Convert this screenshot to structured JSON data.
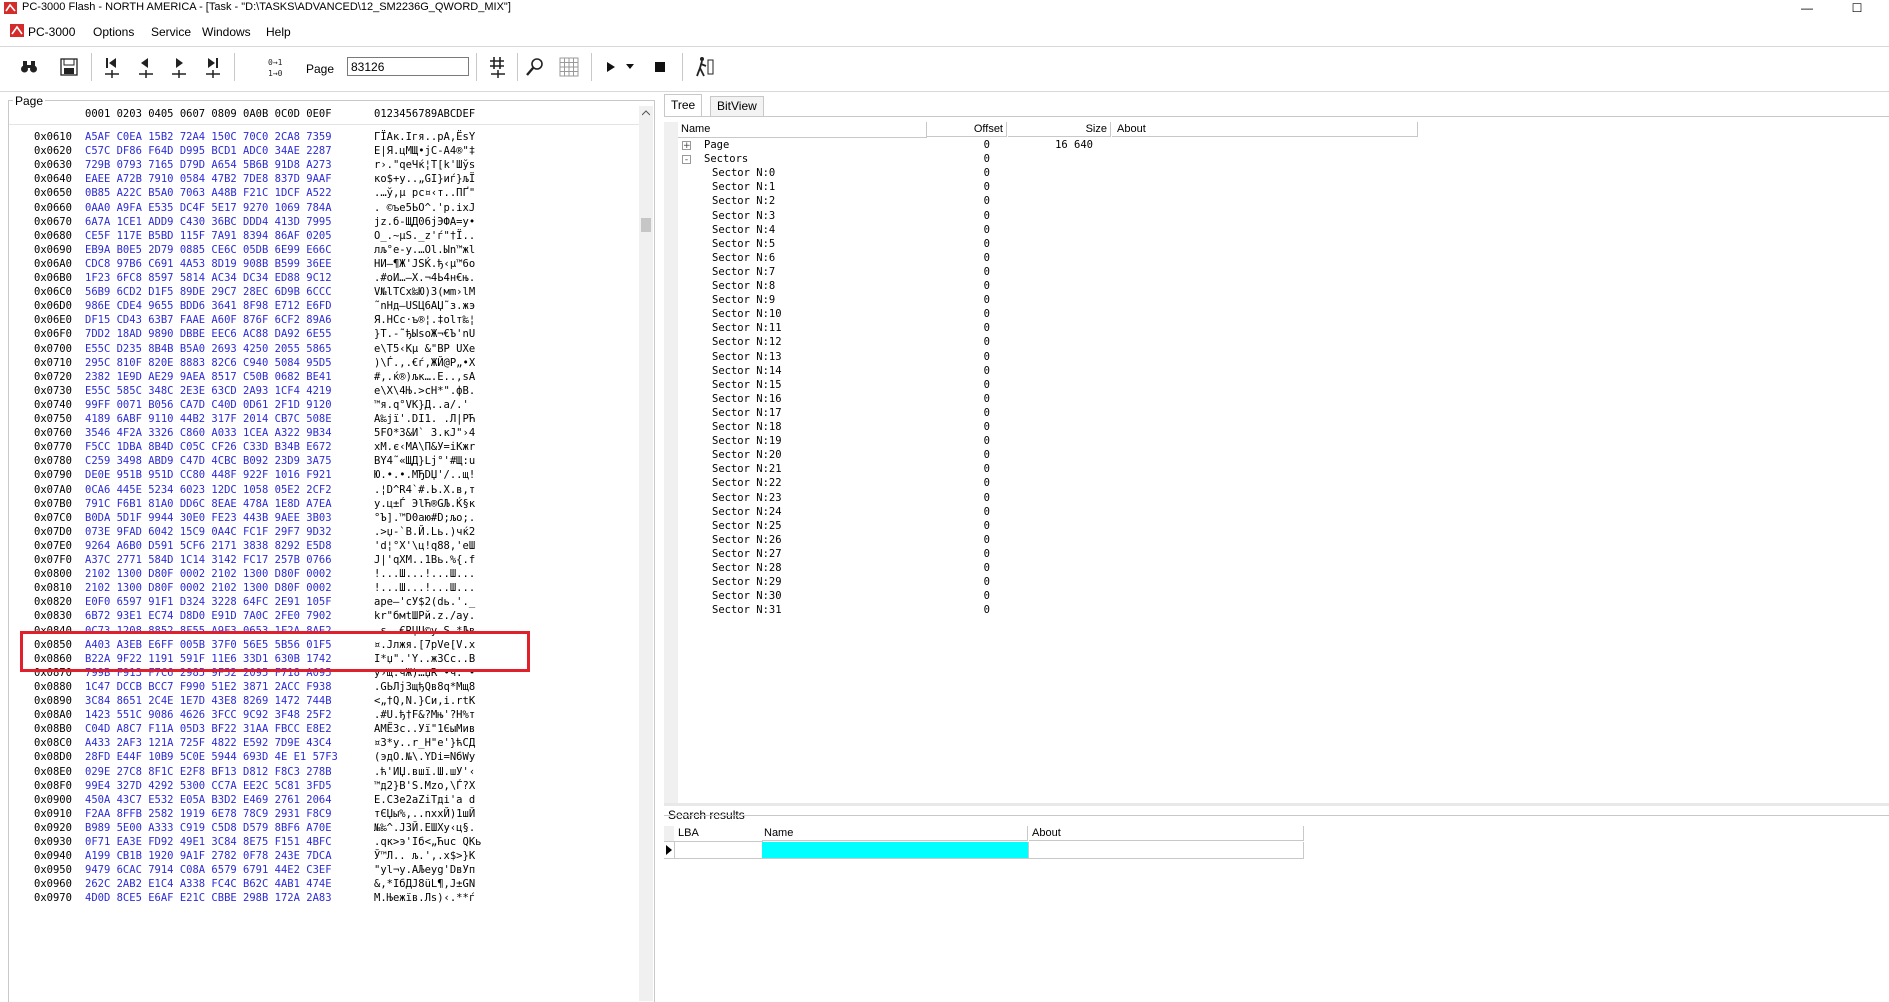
{
  "window": {
    "title": "PC-3000 Flash - NORTH AMERICA - [Task - \"D:\\TASKS\\ADVANCED\\12_SM2236G_QWORD_MIX\"]"
  },
  "menu": {
    "items": [
      "PC-3000",
      "Options",
      "Service",
      "Windows",
      "Help"
    ]
  },
  "toolbar": {
    "page_label": "Page",
    "page_value": "83126"
  },
  "hex_panel": {
    "group_label": "Page",
    "header_columns": "0001 0203 0405 0607 0809 0A0B 0C0D 0E0F",
    "header_ascii": "0123456789ABCDEF",
    "rows": [
      {
        "addr": "0x0610",
        "hex": "A5AF C0EA 15B2 72A4 150C 70C0 2CA8 7359",
        "ascii": "ГЇАк.Ігя..рА,ЁsY"
      },
      {
        "addr": "0x0620",
        "hex": "C57C DF86 F64D D995 BCD1 ADC0 34AE 2287",
        "ascii": "Е|Я.цМЩ•јС-А4®\"‡"
      },
      {
        "addr": "0x0630",
        "hex": "729B 0793 7165 D79D A654 5B6B 91D8 A273",
        "ascii": "r›.\"qeЧќ¦T[k'Шўs"
      },
      {
        "addr": "0x0640",
        "hex": "EAEE A72B 7910 0584 47B2 7DE8 837D 9AAF",
        "ascii": "ко$+y..„GІ}иѓ}љЇ"
      },
      {
        "addr": "0x0650",
        "hex": "0B85 A22C B5A0 7063 A48B F21C 1DCF A522",
        "ascii": ".…ў,µ рс¤‹т..ПҐ\""
      },
      {
        "addr": "0x0660",
        "hex": "0AA0 A9FA E535 DC4F 5E17 9270 1069 784A",
        "ascii": ". ©ъе5ЬO^.'p.ixJ"
      },
      {
        "addr": "0x0670",
        "hex": "6A7A 1CE1 ADD9 C430 36BC DDD4 413D 7995",
        "ascii": "jz.б-ЩД06јЭФA=y•"
      },
      {
        "addr": "0x0680",
        "hex": "CE5F 117E B5BD 115F 7A91 8394 86AF 0205",
        "ascii": "О_.~µЅ._z'ѓ\"†Ї.."
      },
      {
        "addr": "0x0690",
        "hex": "EB9A B0E5 2D79 0885 CE6C 05DB 6E99 E66C",
        "ascii": "лљ°е-y.…Оl.Ыn™жl"
      },
      {
        "addr": "0x06A0",
        "hex": "CDC8 97B6 C691 4A53 8D19 908B B599 36EE",
        "ascii": "НИ—¶Ж'JSЌ.ђ‹µ™6о"
      },
      {
        "addr": "0x06B0",
        "hex": "1F23 6FC8 8597 5814 AC34 DC34 ED88 9C12",
        "ascii": ".#oИ…—X.¬4Ь4н€њ."
      },
      {
        "addr": "0x06C0",
        "hex": "56B9 6CD2 D1F5 89DE 29C7 28EC 6D9B 6CCC",
        "ascii": "V№lТСх‰Ю)З(мm›lМ"
      },
      {
        "addr": "0x06D0",
        "hex": "986E CDE4 9655 BDD6 3641 8F98 E712 E6FD",
        "ascii": "˜nНд–UЅЦ6AЏ˜з.жэ"
      },
      {
        "addr": "0x06E0",
        "hex": "DF15 CD43 63B7 FAAE A60F 876F 6CF2 89A6",
        "ascii": "Я.НCc·ъ®¦.‡olт‰¦"
      },
      {
        "addr": "0x06F0",
        "hex": "7DD2 18AD 9890 DBBE EEC6 AC88 DA92 6E55",
        "ascii": "}Т.-˜ђЫѕоЖ¬€Ъ'nU"
      },
      {
        "addr": "0x0700",
        "hex": "E55C D235 8B4B B5A0 2693 4250 2055 5865",
        "ascii": "е\\Т5‹Kµ &\"BP UXe"
      },
      {
        "addr": "0x0710",
        "hex": "295C 810F 820E 8883 82C6 C940 5084 95D5",
        "ascii": ")\\Ѓ.‚.€ѓ‚ЖЙ@P„•Х"
      },
      {
        "addr": "0x0720",
        "hex": "2382 1E9D AE29 9AEA 8517 C50B 0682 BE41",
        "ascii": "#‚.ќ®)љк….Е..‚ѕA"
      },
      {
        "addr": "0x0730",
        "hex": "E55C 585C 348C 2E3E 63CD 2A93 1CF4 4219",
        "ascii": "е\\X\\4Њ.>cН*\".фB."
      },
      {
        "addr": "0x0740",
        "hex": "99FF 0071 B056 CA7D C40D 0D61 2F1D 9120",
        "ascii": "™я.q°VК}Д..a/.' "
      },
      {
        "addr": "0x0750",
        "hex": "4189 6ABF 9110 44B2 317F 2014 CB7C 508E",
        "ascii": "A‰jї'.DІ1. .Л|PЋ"
      },
      {
        "addr": "0x0760",
        "hex": "3546 4F2A 3326 C860 A033 1CEA A322 9B34",
        "ascii": "5FO*3&И` 3.кЈ\"›4"
      },
      {
        "addr": "0x0770",
        "hex": "F5CC 1DBA 8B4D C05C CF26 C33D B34B E672",
        "ascii": "хМ.є‹MА\\П&У=іKжr"
      },
      {
        "addr": "0x0780",
        "hex": "C259 3498 ABD9 C47D 4CBC B092 23D9 3A75",
        "ascii": "ВY4˜«ЩД}Lј°'#Щ:u"
      },
      {
        "addr": "0x0790",
        "hex": "DE0E 951B 951D CC80 448F 922F 1016 F921",
        "ascii": "Ю.•.•.МЂDЏ'/..щ!"
      },
      {
        "addr": "0x07A0",
        "hex": "0CA6 445E 5234 6023 12DC 1058 05E2 2CF2",
        "ascii": ".¦D^R4`#.Ь.X.в,т"
      },
      {
        "addr": "0x07B0",
        "hex": "791C F6B1 81A0 DD6C 8EAE 478A 1E8D A7EA",
        "ascii": "y.ц±Ѓ ЭlЋ®GЉ.Ќ§к"
      },
      {
        "addr": "0x07C0",
        "hex": "B0DA 5D1F 9944 30E0 FE23 443B 9AEE 3B03",
        "ascii": "°Ъ].™D0аю#D;љо;."
      },
      {
        "addr": "0x07D0",
        "hex": "073E 9FAD 6042 15C9 0A4C FC1F 29F7 9D32",
        "ascii": ".>џ-`B.Й.Lь.)чќ2"
      },
      {
        "addr": "0x07E0",
        "hex": "9264 A6B0 D591 5CF6 2171 3838 8292 E5D8",
        "ascii": "'d¦°Х'\\ц!q88‚'еШ"
      },
      {
        "addr": "0x07F0",
        "hex": "A37C 2771 584D 1C14 3142 FC17 257B 0766",
        "ascii": "Ј|'qXM..1Bь.%{.f"
      },
      {
        "addr": "0x0800",
        "hex": "2102 1300 D80F 0002 2102 1300 D80F 0002",
        "ascii": "!...Ш...!...Ш..."
      },
      {
        "addr": "0x0810",
        "hex": "2102 1300 D80F 0002 2102 1300 D80F 0002",
        "ascii": "!...Ш...!...Ш..."
      },
      {
        "addr": "0x0820",
        "hex": "E0F0 6597 91F1 D324 3228 64FC 2E91 105F",
        "ascii": "арe—'сУ$2(dь.'._"
      },
      {
        "addr": "0x0830",
        "hex": "6B72 93E1 EC74 D8D0 E91D 7A0C 2FE0 7902",
        "ascii": "kr\"бмtШРй.z./аy."
      },
      {
        "addr": "0x0840",
        "hex": "0C73 1208 8852 8F55 A9F3 0653 1F2A 8AE2",
        "ascii": ".s..€RЏU©у.S.*Љв"
      },
      {
        "addr": "0x0850",
        "hex": "A403 A3EB E6FF 005B 37F0 56E5 5B56 01F5",
        "ascii": "¤.Јлжя.[7рVе[V.х"
      },
      {
        "addr": "0x0860",
        "hex": "B22A 9F22 1191 591F 11E6 33D1 630B 1742",
        "ascii": "І*џ\".'Y..ж3Сc..B"
      },
      {
        "addr": "0x0870",
        "hex": "799B F913 F7C6 2985 9F52 2095 F718 A095",
        "ascii": "y›щ.чЖ)…џR •ч. •"
      },
      {
        "addr": "0x0880",
        "hex": "1C47 DCCB BCC7 F990 51E2 3871 2ACC F938",
        "ascii": ".GЬЛјЗщђQв8q*Мщ8"
      },
      {
        "addr": "0x0890",
        "hex": "3C84 8651 2C4E 1E7D 43E8 8269 1472 744B",
        "ascii": "<„†Q,N.}Cи‚i.rtK"
      },
      {
        "addr": "0x08A0",
        "hex": "1423 551C 9086 4626 3FCC 9C92 3F48 25F2",
        "ascii": ".#U.ђ†F&?Мњ'?H%т"
      },
      {
        "addr": "0x08B0",
        "hex": "C04D A8C7 F11A 05D3 BF22 31AA FBCC E8E2",
        "ascii": "АMЁЗс..Уї\"1ЄыМив"
      },
      {
        "addr": "0x08C0",
        "hex": "A433 2AF3 121A 725F 4822 E592 7D9E 43C4",
        "ascii": "¤3*у..r_H\"е'}ћCД"
      },
      {
        "addr": "0x08D0",
        "hex": "28FD E44F 10B9 5C0E 5944 693D 4E E1 57F3",
        "ascii": "(эдO.№\\.YDi=NбWу"
      },
      {
        "addr": "0x08E0",
        "hex": "029E 27C8 8F1C E2F8 BF13 D812 F8C3 278B",
        "ascii": ".ћ'ИЏ.вшї.Ш.шУ'‹"
      },
      {
        "addr": "0x08F0",
        "hex": "99E4 327D 4292 5300 CC7A EE2C 5C81 3FD5",
        "ascii": "™д2}B'S.Мzо,\\Ѓ?Х"
      },
      {
        "addr": "0x0900",
        "hex": "450A 43C7 E532 E05A B3D2 E469 2761 2064",
        "ascii": "E.CЗe2аZіТдi'a d"
      },
      {
        "addr": "0x0910",
        "hex": "F2AA 8FFB 2582 1919 6E78 78C9 2931 F8C9",
        "ascii": "тЄЏы%‚..nxxЙ)1шЙ"
      },
      {
        "addr": "0x0920",
        "hex": "B989 5E00 A333 C919 C5D8 D579 8BF6 A70E",
        "ascii": "№‰^.Ј3Й.ЕШХy‹ц§."
      },
      {
        "addr": "0x0930",
        "hex": "0F71 EA3E FD92 49E1 3C84 8E75 F151 4BFC",
        "ascii": ".qк>э'Iб<„Ћuс QKь"
      },
      {
        "addr": "0x0940",
        "hex": "A199 CB1B 1920 9A1F 2782 0F78 243E 7DCA",
        "ascii": "Ў™Л.. љ.'‚.x$>}К"
      },
      {
        "addr": "0x0950",
        "hex": "9479 6CAC 7914 C08A 6579 6791 44E2 C3EF",
        "ascii": "\"yl¬y.АЉeyg'DвУп"
      },
      {
        "addr": "0x0960",
        "hex": "262C 2AB2 E1C4 A338 FC4C B62C 4AB1 474E",
        "ascii": "&,*ІбДЈ8üL¶,J±GN"
      },
      {
        "addr": "0x0970",
        "hex": "4D0D 8CE5 E6AF E21C CBBE 298B 172A 2A83",
        "ascii": "M.Њежїв.Лѕ)‹.**ѓ"
      }
    ]
  },
  "tabs": [
    "Tree",
    "BitView"
  ],
  "tree": {
    "columns": [
      "Name",
      "Offset",
      "Size",
      "About"
    ],
    "rows": [
      {
        "name": "Page",
        "offset": "0",
        "size": "16 640",
        "level": 1,
        "expander": "+"
      },
      {
        "name": "Sectors",
        "offset": "0",
        "size": "",
        "level": 1,
        "expander": "-"
      },
      {
        "name": "Sector N:0",
        "offset": "0",
        "size": "",
        "level": 2
      },
      {
        "name": "Sector N:1",
        "offset": "0",
        "size": "",
        "level": 2
      },
      {
        "name": "Sector N:2",
        "offset": "0",
        "size": "",
        "level": 2
      },
      {
        "name": "Sector N:3",
        "offset": "0",
        "size": "",
        "level": 2
      },
      {
        "name": "Sector N:4",
        "offset": "0",
        "size": "",
        "level": 2
      },
      {
        "name": "Sector N:5",
        "offset": "0",
        "size": "",
        "level": 2
      },
      {
        "name": "Sector N:6",
        "offset": "0",
        "size": "",
        "level": 2
      },
      {
        "name": "Sector N:7",
        "offset": "0",
        "size": "",
        "level": 2
      },
      {
        "name": "Sector N:8",
        "offset": "0",
        "size": "",
        "level": 2
      },
      {
        "name": "Sector N:9",
        "offset": "0",
        "size": "",
        "level": 2
      },
      {
        "name": "Sector N:10",
        "offset": "0",
        "size": "",
        "level": 2
      },
      {
        "name": "Sector N:11",
        "offset": "0",
        "size": "",
        "level": 2
      },
      {
        "name": "Sector N:12",
        "offset": "0",
        "size": "",
        "level": 2
      },
      {
        "name": "Sector N:13",
        "offset": "0",
        "size": "",
        "level": 2
      },
      {
        "name": "Sector N:14",
        "offset": "0",
        "size": "",
        "level": 2
      },
      {
        "name": "Sector N:15",
        "offset": "0",
        "size": "",
        "level": 2
      },
      {
        "name": "Sector N:16",
        "offset": "0",
        "size": "",
        "level": 2
      },
      {
        "name": "Sector N:17",
        "offset": "0",
        "size": "",
        "level": 2
      },
      {
        "name": "Sector N:18",
        "offset": "0",
        "size": "",
        "level": 2
      },
      {
        "name": "Sector N:19",
        "offset": "0",
        "size": "",
        "level": 2
      },
      {
        "name": "Sector N:20",
        "offset": "0",
        "size": "",
        "level": 2
      },
      {
        "name": "Sector N:21",
        "offset": "0",
        "size": "",
        "level": 2
      },
      {
        "name": "Sector N:22",
        "offset": "0",
        "size": "",
        "level": 2
      },
      {
        "name": "Sector N:23",
        "offset": "0",
        "size": "",
        "level": 2
      },
      {
        "name": "Sector N:24",
        "offset": "0",
        "size": "",
        "level": 2
      },
      {
        "name": "Sector N:25",
        "offset": "0",
        "size": "",
        "level": 2
      },
      {
        "name": "Sector N:26",
        "offset": "0",
        "size": "",
        "level": 2
      },
      {
        "name": "Sector N:27",
        "offset": "0",
        "size": "",
        "level": 2
      },
      {
        "name": "Sector N:28",
        "offset": "0",
        "size": "",
        "level": 2
      },
      {
        "name": "Sector N:29",
        "offset": "0",
        "size": "",
        "level": 2
      },
      {
        "name": "Sector N:30",
        "offset": "0",
        "size": "",
        "level": 2
      },
      {
        "name": "Sector N:31",
        "offset": "0",
        "size": "",
        "level": 2
      }
    ]
  },
  "search": {
    "label": "Search results",
    "columns": [
      "LBA",
      "Name",
      "About"
    ]
  },
  "colors": {
    "hex_text": "#2b2bd9",
    "highlight_border": "#e0202a",
    "search_name_cell": "#00ffff"
  },
  "icons": {
    "toolbar": [
      "binoculars-icon",
      "save-icon",
      "first-page-icon",
      "prev-page-icon",
      "next-page-icon",
      "last-page-icon",
      "bit-transform-icon",
      "goto-offset-icon",
      "search-icon",
      "grid-icon",
      "play-icon",
      "dropdown-arrow-icon",
      "stop-icon",
      "run-script-icon"
    ]
  }
}
